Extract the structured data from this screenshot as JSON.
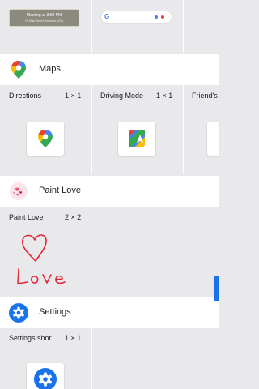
{
  "top_row": {
    "preview_title": "Meeting at 3:00 PM",
    "preview_subtitle": "10 Main Street, Anytown, USA",
    "search_logo": "G"
  },
  "sections": [
    {
      "app": "Maps",
      "icon": "google-maps-pin-icon",
      "widgets": [
        {
          "label": "Directions",
          "size": "1 × 1",
          "icon": "maps-pin-icon"
        },
        {
          "label": "Driving Mode",
          "size": "1 × 1",
          "icon": "maps-driving-icon"
        },
        {
          "label": "Friend's",
          "size": "",
          "icon": ""
        }
      ]
    },
    {
      "app": "Paint Love",
      "icon": "paint-love-hearts-icon",
      "widgets": [
        {
          "label": "Paint Love",
          "size": "2 × 2",
          "icon": "love-drawing"
        }
      ]
    },
    {
      "app": "Settings",
      "icon": "gear-icon",
      "widgets": [
        {
          "label": "Settings shor...",
          "size": "1 × 1",
          "icon": "gear-icon"
        }
      ]
    }
  ],
  "colors": {
    "background": "#e9e9ec",
    "header_bg": "#ffffff",
    "accent_blue": "#1a73e8",
    "love_red": "#e32636"
  }
}
